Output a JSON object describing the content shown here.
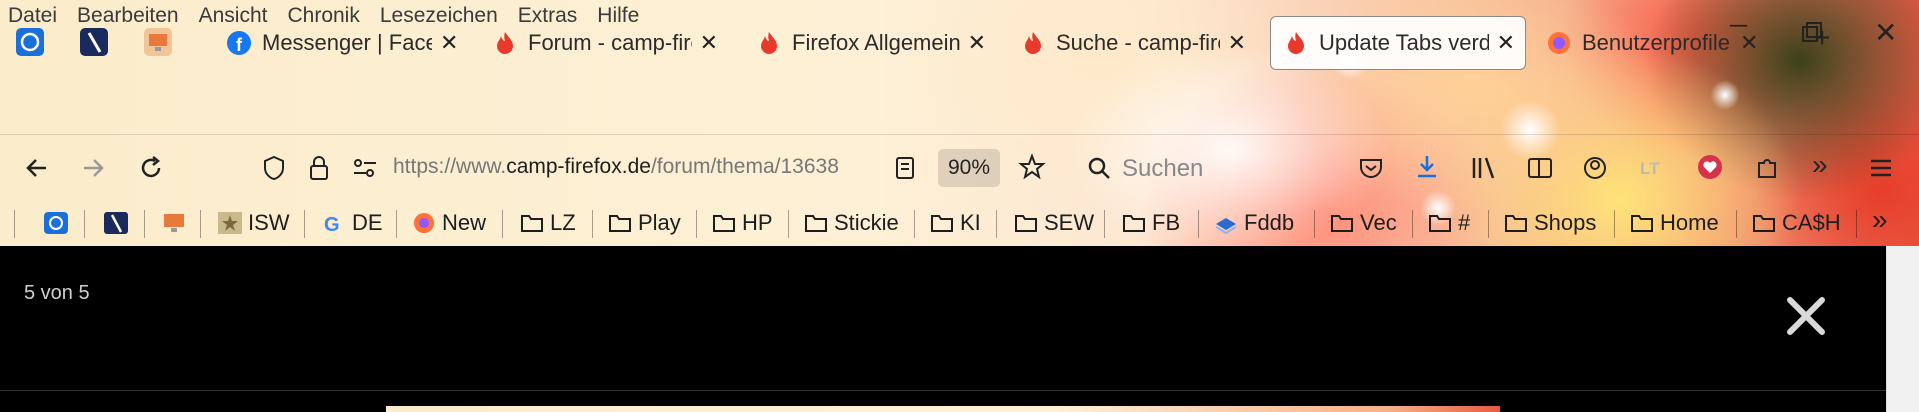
{
  "menu": {
    "items": [
      "Datei",
      "Bearbeiten",
      "Ansicht",
      "Chronik",
      "Lesezeichen",
      "Extras",
      "Hilfe"
    ]
  },
  "tabs": [
    {
      "title": "Messenger | Facebook",
      "favicon": "facebook-icon"
    },
    {
      "title": "Forum - camp-firefox",
      "favicon": "firefox-flame-icon"
    },
    {
      "title": "Firefox Allgemein",
      "favicon": "firefox-flame-icon"
    },
    {
      "title": "Suche - camp-firefox",
      "favicon": "firefox-flame-icon"
    },
    {
      "title": "Update Tabs verdrängen",
      "favicon": "firefox-flame-icon",
      "active": true
    },
    {
      "title": "Benutzerprofile",
      "favicon": "firefox-profile-icon"
    }
  ],
  "nav": {
    "url_prefix": "https://www.",
    "url_host": "camp-firefox.de",
    "url_path": "/forum/thema/13638",
    "zoom": "90%",
    "search_placeholder": "Suchen"
  },
  "bookmarks": [
    {
      "label": "ISW",
      "icon": "star-icon"
    },
    {
      "label": "DE",
      "icon": "google-icon"
    },
    {
      "label": "New",
      "icon": "firefox-icon"
    },
    {
      "label": "LZ",
      "icon": "folder-icon"
    },
    {
      "label": "Play",
      "icon": "folder-icon"
    },
    {
      "label": "HP",
      "icon": "folder-icon"
    },
    {
      "label": "Stickie",
      "icon": "folder-icon"
    },
    {
      "label": "KI",
      "icon": "folder-icon"
    },
    {
      "label": "SEW",
      "icon": "folder-icon"
    },
    {
      "label": "FB",
      "icon": "folder-icon"
    },
    {
      "label": "Fddb",
      "icon": "fddb-icon"
    },
    {
      "label": "Vec",
      "icon": "folder-icon"
    },
    {
      "label": "#",
      "icon": "folder-icon"
    },
    {
      "label": "Shops",
      "icon": "folder-icon"
    },
    {
      "label": "Home",
      "icon": "folder-icon"
    },
    {
      "label": "CA$H",
      "icon": "folder-icon"
    }
  ],
  "viewer": {
    "counter": "5 von 5"
  },
  "colors": {
    "accent_blue": "#1a6fd8",
    "flame": "#e8392c",
    "pocket_red": "#d6334a"
  }
}
